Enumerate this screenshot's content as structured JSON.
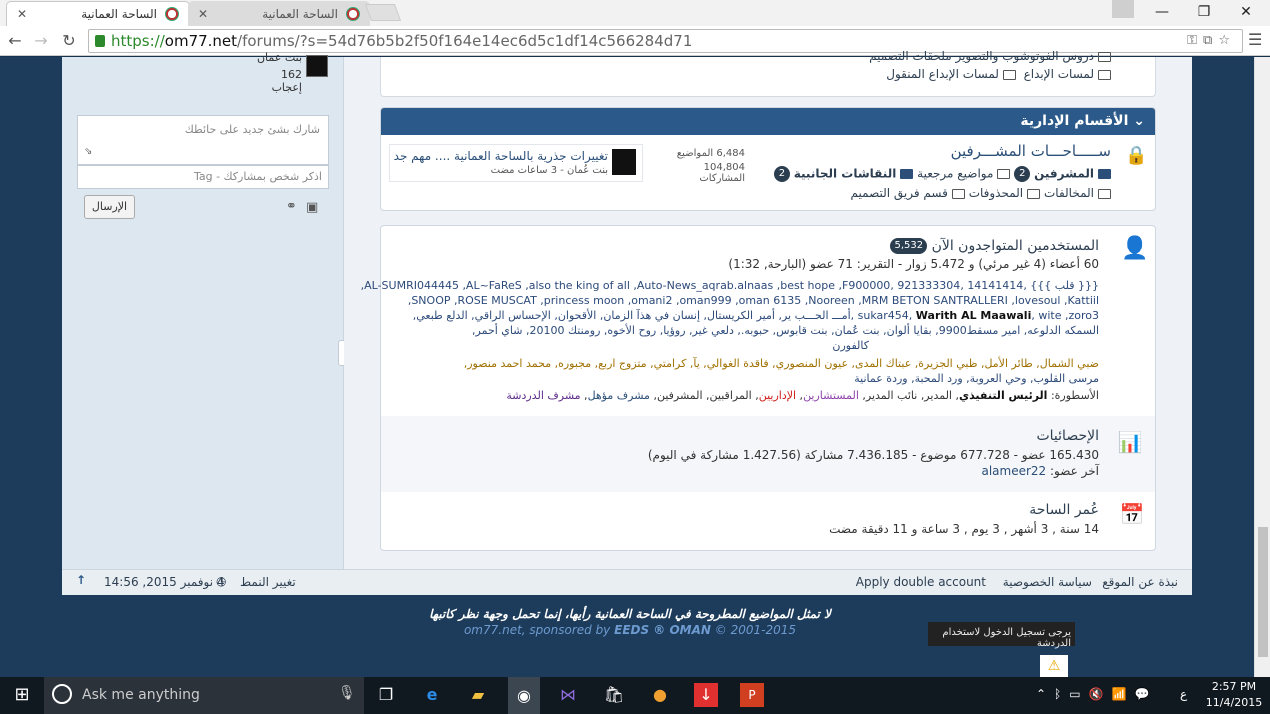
{
  "browser": {
    "tabs": [
      {
        "title": "الساحة العمانية",
        "active": true
      },
      {
        "title": "الساحة العمانية",
        "active": false
      }
    ],
    "url_scheme": "https://",
    "url_host": "om77.net",
    "url_path": "/forums/?s=54d76b5b2f50f164e14ec6d5c1df14c566284d71"
  },
  "sidebar": {
    "user_name": "بنت عمان",
    "user_likes": "162 إعجاب",
    "status_placeholder": "شارك بشئ جديد على حائطك",
    "tag_placeholder": "اذكر شخص بمشاركك - Tag",
    "send_label": "الإرسال"
  },
  "top_forums": {
    "row1": "دروس الفوتوشوب والتصوير    ملحقات التصميم",
    "row2a": "لمسات الإبداع",
    "row2b": "لمسات الإبداع المنقول"
  },
  "admin_category": {
    "title": "الأقسام الإدارية",
    "forum_title": "ســـــاحـــات المشـــرفين",
    "sub1": "المشرفين",
    "sub1_badge": "2",
    "sub2": "مواضيع مرجعية",
    "sub3": "النقاشات الجانبية",
    "sub3_badge": "2",
    "sub4": "المخالفات",
    "sub5": "المحذوفات",
    "sub6": "قسم فريق التصميم",
    "threads": "6,484 المواضيع",
    "posts": "104,804 المشاركات",
    "last_title": "تغييرات جذرية بالساحة العمانية .... مهم جداً!",
    "last_meta": "بنت عُمان - 3 ساعات مضت"
  },
  "online": {
    "title": "المستخدمين المتواجدون الآن",
    "count": "5,532",
    "summary": "60 أعضاء (4 غير مرئي) و 5.472 زوار - التقرير: 71 عضو (البارحة, 1:32)",
    "users_line1": "{{{ قلب }}} ,14141414 ,921333304 ,AL-SUMRI044445 ,AL~FaReS ,also the king of all ,Auto-News_aqrab.alnaas ,best hope ,F900000,",
    "users_line2": "SNOOP ,ROSE MUSCAT ,princess moon ,omani2 ,oman999 ,oman 6135 ,Nooreen ,MRM BETON SANTRALLERI ,lovesoul ,Kattiil,",
    "users_line3a": "sukar454, ",
    "users_line3b": "Warith AL Maawali",
    "users_line3c": ", wite ,zoro3 ,أمـــ الحـــب ير, أمير الكريستال, إنسان في هذآ الزمان, الأقحوان, الإحساس الراقي, الدلع طبعي,",
    "users_line4": "السمكه الدلوعه, امير مسقط9900, بقايا ألوان, بنت عُمان, بنت قابوس, حبوبه., دلعي غير, روؤيا, روح الأخوه, رومنتك 20100, شاي أحمر,",
    "users_line5": "كالفورن",
    "users_line6": "ضبي الشمال, طائر الأمل, ظبي الجزيرة, عبتاك المدى, عيون المنصوري, فاقدة الغوالي, يآ,          كرامتي, متزوج اربع, مجبوره, محمد احمد منصور,",
    "users_line7": "مرسى القلوب, وحي العروبة, ورد المحبة, وردة عمانية",
    "legend_label": "الأسطورة:",
    "legend_exec": "الرئيس التنفيذي",
    "legend_rest1": ", المدير, نائب المدير,",
    "legend_consult": "المستشارين",
    "legend_admins": "الإداريين",
    "legend_rest2": ", المراقبين, المشرفين,",
    "legend_qual": "مشرف مؤهل",
    "legend_chat": "مشرف الدردشة"
  },
  "stats": {
    "title": "الإحصائيات",
    "line": "165.430 عضو - 677.728 موضوع - 7.436.185 مشاركة (1.427.56 مشاركة في اليوم)",
    "last_member_label": "آخر عضو:",
    "last_member": "alameer22"
  },
  "age": {
    "title": "عُمر الساحة",
    "line": "14 سنة , 3 أشهر , 3 يوم , 3 ساعة و 11 دقيقة مضت"
  },
  "footer": {
    "about": "نبذة عن الموقع",
    "privacy": "سياسة الخصوصية",
    "double": "Apply double account",
    "datetime": "4 نوفمبر 2015, 14:56",
    "style": "تغيير النمط"
  },
  "disclaimer": "لا تمثل المواضيع المطروحة في الساحة العمانية رأيها، إنما تحمل وجهة نظر كاتبها",
  "sponsor_a": "om77.net, sponsored by",
  "sponsor_b": "EEDS ® OMAN",
  "sponsor_c": "© 2001-2015",
  "tooltip": "يرجى تسجيل الدخول لاستخدام الدردشة",
  "taskbar": {
    "search": "Ask me anything",
    "time": "2:57 PM",
    "date": "11/4/2015",
    "lang": "ع"
  },
  "colors": {
    "header_blue": "#2b5a8a",
    "page_bg": "#1d3b5a",
    "accent_red": "#d0201c"
  }
}
